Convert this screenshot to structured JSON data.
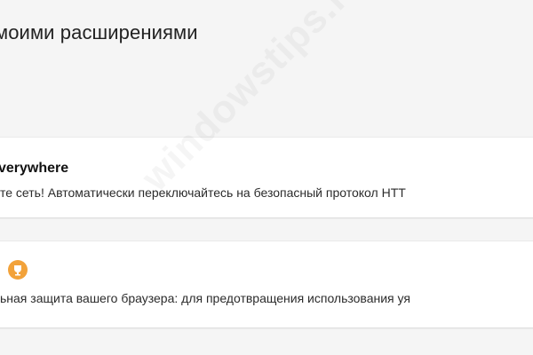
{
  "page": {
    "title": "моими расширениями"
  },
  "extensions": [
    {
      "name": "verywhere",
      "description": "те сеть! Автоматически переключайтесь на безопасный протокол HTT"
    },
    {
      "icon": "trophy-icon",
      "description": "ьная защита вашего браузера: для предотвращения использования уя"
    }
  ],
  "watermark": "windowstips.ru",
  "colors": {
    "background": "#f5f5f5",
    "card": "#ffffff",
    "badge": "#f2a23a"
  }
}
